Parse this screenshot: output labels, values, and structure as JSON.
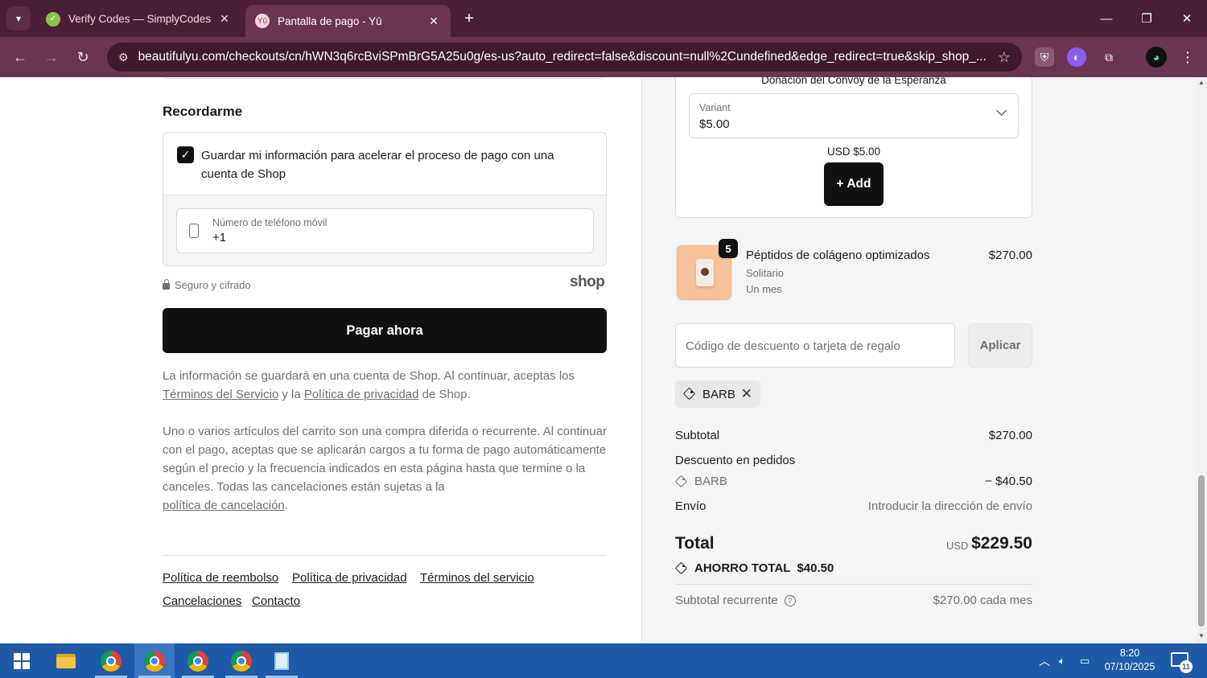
{
  "browser": {
    "tabs": [
      {
        "title": "Verify Codes — SimplyCodes",
        "active": false
      },
      {
        "title": "Pantalla de pago - Yū",
        "active": true
      }
    ],
    "url": "beautifulyu.com/checkouts/cn/hWN3q6rcBviSPmBrG5A25u0g/es-us?auto_redirect=false&discount=null%2Cundefined&edge_redirect=true&skip_shop_..."
  },
  "remember": {
    "title": "Recordarme",
    "checkbox_label": "Guardar mi información para acelerar el proceso de pago con una cuenta de Shop",
    "checked": true,
    "phone_label": "Número de teléfono móvil",
    "phone_value": "+1"
  },
  "secure_text": "Seguro y cifrado",
  "shop_logo": "shop",
  "pay_button": "Pagar ahora",
  "legal": {
    "p1_a": "La información se guardará en una cuenta de Shop. Al continuar, aceptas los",
    "terms_link": "Términos del Servicio",
    "p1_b": " y la ",
    "privacy_link": "Política de privacidad",
    "p1_c": " de Shop.",
    "p2_a": "Uno o varios artículos del carrito son una compra diferida o recurrente. Al continuar con el pago, aceptas que se aplicarán cargos a tu forma de pago automáticamente según el precio y la frecuencia indicados en esta página hasta que termine o la canceles. Todas las cancelaciones están sujetas a la",
    "cancel_link": "política de cancelación",
    "p2_b": "."
  },
  "footer_links": {
    "refund": "Política de reembolso",
    "privacy": "Política de privacidad",
    "terms": "Términos del servicio",
    "cancellations": "Cancelaciones",
    "contact": "Contacto"
  },
  "upsell": {
    "name": "Donación del Convoy de la Esperanza",
    "variant_label": "Variant",
    "variant_value": "$5.00",
    "price": "USD $5.00",
    "add_button": "+ Add"
  },
  "product": {
    "quantity": "5",
    "name": "Péptidos de colágeno optimizados",
    "option1": "Solitario",
    "option2": "Un mes",
    "price": "$270.00"
  },
  "discount": {
    "placeholder": "Código de descuento o tarjeta de regalo",
    "apply_button": "Aplicar",
    "applied_code": "BARB"
  },
  "summary": {
    "subtotal_label": "Subtotal",
    "subtotal_value": "$270.00",
    "order_discount_label": "Descuento en pedidos",
    "discount_code": "BARB",
    "discount_value": "− $40.50",
    "shipping_label": "Envío",
    "shipping_value": "Introducir la dirección de envío",
    "total_label": "Total",
    "total_currency": "USD",
    "total_value": "$229.50",
    "savings_label": "AHORRO TOTAL",
    "savings_value": "$40.50",
    "recurring_label": "Subtotal recurrente",
    "recurring_value": "$270.00 cada mes"
  },
  "taskbar": {
    "time": "8:20",
    "date": "07/10/2025",
    "notifications": "11"
  },
  "colors": {
    "tabbar": "#4a1f35",
    "toolbar": "#6a3550",
    "primary_button": "#111111",
    "taskbar": "#1e5aa8"
  }
}
